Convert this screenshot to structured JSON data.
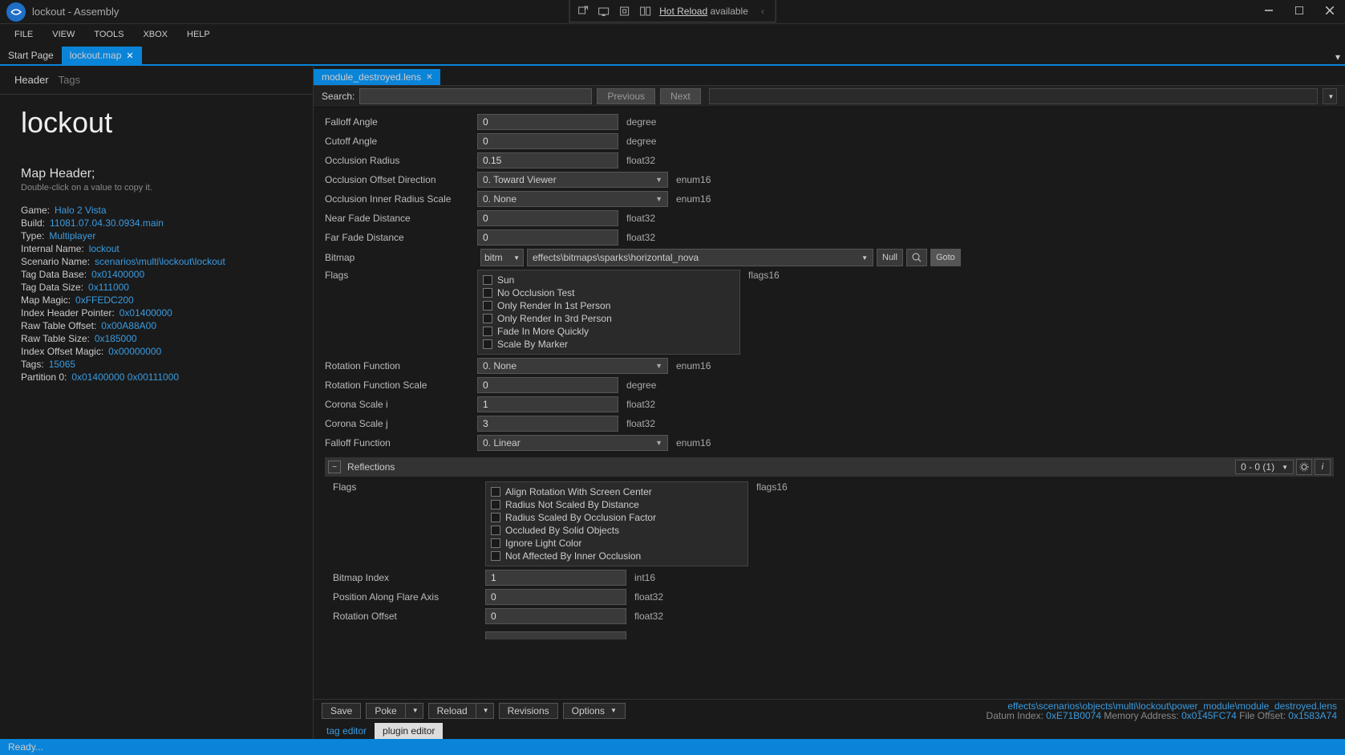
{
  "window": {
    "title": "lockout - Assembly"
  },
  "hot_reload": {
    "label": "Hot Reload",
    "suffix": "available"
  },
  "menubar": [
    "FILE",
    "VIEW",
    "TOOLS",
    "XBOX",
    "HELP"
  ],
  "tabs": {
    "start": "Start Page",
    "map": "lockout.map"
  },
  "left": {
    "tabs": {
      "header": "Header",
      "tags": "Tags"
    },
    "title": "lockout",
    "section_title": "Map Header;",
    "section_sub": "Double-click on a value to copy it.",
    "kv": [
      {
        "k": "Game:",
        "v": "Halo 2 Vista"
      },
      {
        "k": "Build:",
        "v": "11081.07.04.30.0934.main"
      },
      {
        "k": "Type:",
        "v": "Multiplayer"
      },
      {
        "k": "Internal Name:",
        "v": "lockout"
      },
      {
        "k": "Scenario Name:",
        "v": "scenarios\\multi\\lockout\\lockout"
      },
      {
        "k": "Tag Data Base:",
        "v": "0x01400000"
      },
      {
        "k": "Tag Data Size:",
        "v": "0x111000"
      },
      {
        "k": "Map Magic:",
        "v": "0xFFEDC200"
      },
      {
        "k": "Index Header Pointer:",
        "v": "0x01400000"
      },
      {
        "k": "Raw Table Offset:",
        "v": "0x00A88A00"
      },
      {
        "k": "Raw Table Size:",
        "v": "0x185000"
      },
      {
        "k": "Index Offset Magic:",
        "v": "0x00000000"
      },
      {
        "k": "Tags:",
        "v": "15065"
      },
      {
        "k": "Partition 0:",
        "v": "0x01400000 0x00111000"
      }
    ]
  },
  "doc_tab": {
    "name": "module_destroyed.lens"
  },
  "search": {
    "label": "Search:",
    "prev": "Previous",
    "next": "Next"
  },
  "fields": {
    "falloff_angle": {
      "label": "Falloff Angle",
      "value": "0",
      "type": "degree"
    },
    "cutoff_angle": {
      "label": "Cutoff Angle",
      "value": "0",
      "type": "degree"
    },
    "occlusion_radius": {
      "label": "Occlusion Radius",
      "value": "0.15",
      "type": "float32"
    },
    "occlusion_offset_dir": {
      "label": "Occlusion Offset Direction",
      "value": "0. Toward Viewer",
      "type": "enum16"
    },
    "occlusion_inner_radius": {
      "label": "Occlusion Inner Radius Scale",
      "value": "0. None",
      "type": "enum16"
    },
    "near_fade": {
      "label": "Near Fade Distance",
      "value": "0",
      "type": "float32"
    },
    "far_fade": {
      "label": "Far Fade Distance",
      "value": "0",
      "type": "float32"
    },
    "bitmap": {
      "label": "Bitmap",
      "class": "bitm",
      "path": "effects\\bitmaps\\sparks\\horizontal_nova"
    },
    "flags": {
      "label": "Flags",
      "type": "flags16",
      "items": [
        "Sun",
        "No Occlusion Test",
        "Only Render In 1st Person",
        "Only Render In 3rd Person",
        "Fade In More Quickly",
        "Scale By Marker"
      ]
    },
    "rotation_function": {
      "label": "Rotation Function",
      "value": "0. None",
      "type": "enum16"
    },
    "rotation_function_scale": {
      "label": "Rotation Function Scale",
      "value": "0",
      "type": "degree"
    },
    "corona_i": {
      "label": "Corona Scale i",
      "value": "1",
      "type": "float32"
    },
    "corona_j": {
      "label": "Corona Scale j",
      "value": "3",
      "type": "float32"
    },
    "falloff_function": {
      "label": "Falloff Function",
      "value": "0. Linear",
      "type": "enum16"
    }
  },
  "reflections": {
    "title": "Reflections",
    "counter": "0 - 0 (1)",
    "flags": {
      "label": "Flags",
      "type": "flags16",
      "items": [
        "Align Rotation With Screen Center",
        "Radius Not Scaled By Distance",
        "Radius Scaled By Occlusion Factor",
        "Occluded By Solid Objects",
        "Ignore Light Color",
        "Not Affected By Inner Occlusion"
      ]
    },
    "bitmap_index": {
      "label": "Bitmap Index",
      "value": "1",
      "type": "int16"
    },
    "position": {
      "label": "Position Along Flare Axis",
      "value": "0",
      "type": "float32"
    },
    "rotation_offset": {
      "label": "Rotation Offset",
      "value": "0",
      "type": "float32"
    }
  },
  "bottom_btns": {
    "save": "Save",
    "poke": "Poke",
    "reload": "Reload",
    "revisions": "Revisions",
    "options": "Options"
  },
  "tag_ref": {
    "null": "Null",
    "goto": "Goto"
  },
  "path_info": {
    "path": "effects\\scenarios\\objects\\multi\\lockout\\power_module\\module_destroyed.lens",
    "datum_label": "Datum Index:",
    "datum": "0xE71B0074",
    "mem_label": "Memory Address:",
    "mem": "0x0145FC74",
    "off_label": "File Offset:",
    "off": "0x1583A74"
  },
  "editor_tabs": {
    "tag": "tag editor",
    "plugin": "plugin editor"
  },
  "status": "Ready..."
}
